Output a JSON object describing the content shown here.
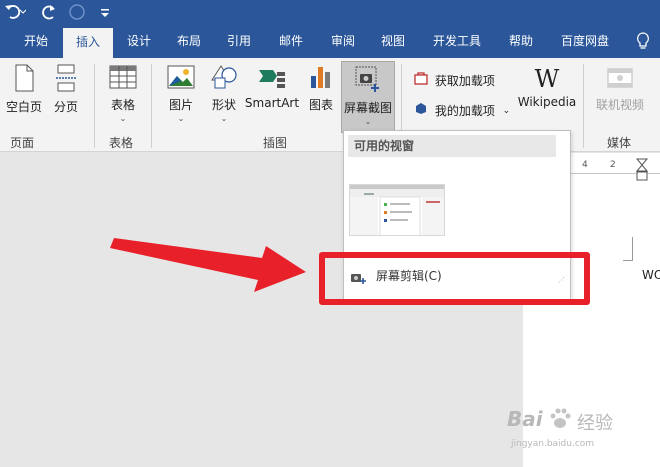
{
  "qat": {
    "undo_icon": "undo-icon",
    "redo_icon": "redo-icon",
    "circle_icon": "circle-icon",
    "customize_icon": "customize-qat-icon"
  },
  "tabs": [
    {
      "label": "开始",
      "active": false
    },
    {
      "label": "插入",
      "active": true
    },
    {
      "label": "设计",
      "active": false
    },
    {
      "label": "布局",
      "active": false
    },
    {
      "label": "引用",
      "active": false
    },
    {
      "label": "邮件",
      "active": false
    },
    {
      "label": "审阅",
      "active": false
    },
    {
      "label": "视图",
      "active": false
    },
    {
      "label": "开发工具",
      "active": false
    },
    {
      "label": "帮助",
      "active": false
    },
    {
      "label": "百度网盘",
      "active": false
    }
  ],
  "ribbon": {
    "blank_page": "空白页",
    "page_break": "分页",
    "table": "表格",
    "picture": "图片",
    "shapes": "形状",
    "smartart": "SmartArt",
    "chart": "图表",
    "screenshot": "屏幕截图",
    "get_addins": "获取加载项",
    "my_addins": "我的加载项",
    "wikipedia": "Wikipedia",
    "wikipedia_logo": "W",
    "online_video": "联机视频",
    "groups": {
      "pages": "页面",
      "tables": "表格",
      "illustrations": "插图",
      "media": "媒体"
    }
  },
  "ruler": {
    "mark1": "4",
    "mark2": "2"
  },
  "doc_text": "WO",
  "dropdown": {
    "header": "可用的视窗",
    "clipping_item": "屏幕剪辑(C)"
  },
  "colors": {
    "title_bar": "#2b579a",
    "ribbon_bg": "#f3f3f3",
    "annotation_red": "#e8202a"
  },
  "watermark": {
    "line1": "Bai",
    "line2": "经验",
    "line3": "jingyan.baidu.com"
  }
}
